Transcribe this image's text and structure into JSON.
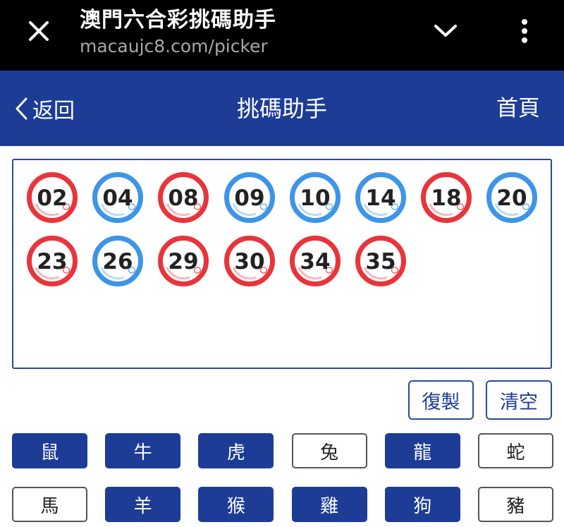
{
  "browser": {
    "title": "澳門六合彩挑碼助手",
    "url": "macaujc8.com/picker",
    "close_icon": "close-icon",
    "chevron_icon": "chevron-down-icon",
    "menu_icon": "more-vert-icon"
  },
  "nav": {
    "back_label": "返回",
    "title": "挑碼助手",
    "home_label": "首頁"
  },
  "colors": {
    "nav_blue": "#1c3c96",
    "ball_red": "#e8353b",
    "ball_blue": "#3d95e8"
  },
  "selected_numbers": [
    {
      "num": "02",
      "color": "red"
    },
    {
      "num": "04",
      "color": "blue"
    },
    {
      "num": "08",
      "color": "red"
    },
    {
      "num": "09",
      "color": "blue"
    },
    {
      "num": "10",
      "color": "blue"
    },
    {
      "num": "14",
      "color": "blue"
    },
    {
      "num": "18",
      "color": "red"
    },
    {
      "num": "20",
      "color": "blue"
    },
    {
      "num": "23",
      "color": "red"
    },
    {
      "num": "26",
      "color": "blue"
    },
    {
      "num": "29",
      "color": "red"
    },
    {
      "num": "30",
      "color": "red"
    },
    {
      "num": "34",
      "color": "red"
    },
    {
      "num": "35",
      "color": "red"
    }
  ],
  "actions": {
    "copy_label": "復製",
    "clear_label": "清空"
  },
  "zodiacs": [
    {
      "label": "鼠",
      "selected": true
    },
    {
      "label": "牛",
      "selected": true
    },
    {
      "label": "虎",
      "selected": true
    },
    {
      "label": "兔",
      "selected": false
    },
    {
      "label": "龍",
      "selected": true
    },
    {
      "label": "蛇",
      "selected": false
    },
    {
      "label": "馬",
      "selected": false
    },
    {
      "label": "羊",
      "selected": true
    },
    {
      "label": "猴",
      "selected": true
    },
    {
      "label": "雞",
      "selected": true
    },
    {
      "label": "狗",
      "selected": true
    },
    {
      "label": "豬",
      "selected": false
    }
  ]
}
